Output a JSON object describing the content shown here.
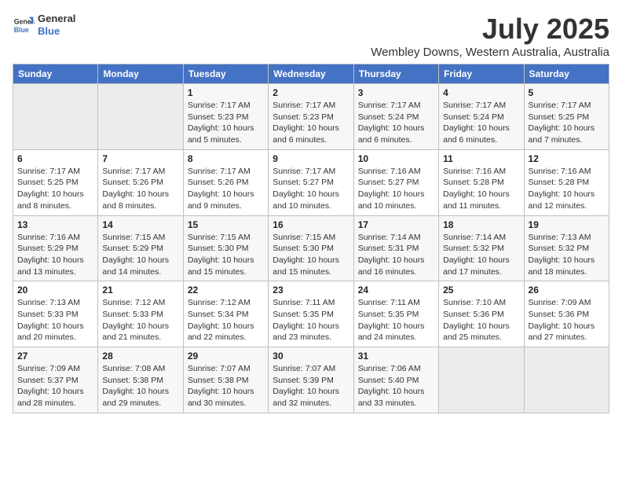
{
  "header": {
    "logo_line1": "General",
    "logo_line2": "Blue",
    "month": "July 2025",
    "location": "Wembley Downs, Western Australia, Australia"
  },
  "weekdays": [
    "Sunday",
    "Monday",
    "Tuesday",
    "Wednesday",
    "Thursday",
    "Friday",
    "Saturday"
  ],
  "weeks": [
    [
      {
        "day": "",
        "info": ""
      },
      {
        "day": "",
        "info": ""
      },
      {
        "day": "1",
        "info": "Sunrise: 7:17 AM\nSunset: 5:23 PM\nDaylight: 10 hours and 5 minutes."
      },
      {
        "day": "2",
        "info": "Sunrise: 7:17 AM\nSunset: 5:23 PM\nDaylight: 10 hours and 6 minutes."
      },
      {
        "day": "3",
        "info": "Sunrise: 7:17 AM\nSunset: 5:24 PM\nDaylight: 10 hours and 6 minutes."
      },
      {
        "day": "4",
        "info": "Sunrise: 7:17 AM\nSunset: 5:24 PM\nDaylight: 10 hours and 6 minutes."
      },
      {
        "day": "5",
        "info": "Sunrise: 7:17 AM\nSunset: 5:25 PM\nDaylight: 10 hours and 7 minutes."
      }
    ],
    [
      {
        "day": "6",
        "info": "Sunrise: 7:17 AM\nSunset: 5:25 PM\nDaylight: 10 hours and 8 minutes."
      },
      {
        "day": "7",
        "info": "Sunrise: 7:17 AM\nSunset: 5:26 PM\nDaylight: 10 hours and 8 minutes."
      },
      {
        "day": "8",
        "info": "Sunrise: 7:17 AM\nSunset: 5:26 PM\nDaylight: 10 hours and 9 minutes."
      },
      {
        "day": "9",
        "info": "Sunrise: 7:17 AM\nSunset: 5:27 PM\nDaylight: 10 hours and 10 minutes."
      },
      {
        "day": "10",
        "info": "Sunrise: 7:16 AM\nSunset: 5:27 PM\nDaylight: 10 hours and 10 minutes."
      },
      {
        "day": "11",
        "info": "Sunrise: 7:16 AM\nSunset: 5:28 PM\nDaylight: 10 hours and 11 minutes."
      },
      {
        "day": "12",
        "info": "Sunrise: 7:16 AM\nSunset: 5:28 PM\nDaylight: 10 hours and 12 minutes."
      }
    ],
    [
      {
        "day": "13",
        "info": "Sunrise: 7:16 AM\nSunset: 5:29 PM\nDaylight: 10 hours and 13 minutes."
      },
      {
        "day": "14",
        "info": "Sunrise: 7:15 AM\nSunset: 5:29 PM\nDaylight: 10 hours and 14 minutes."
      },
      {
        "day": "15",
        "info": "Sunrise: 7:15 AM\nSunset: 5:30 PM\nDaylight: 10 hours and 15 minutes."
      },
      {
        "day": "16",
        "info": "Sunrise: 7:15 AM\nSunset: 5:30 PM\nDaylight: 10 hours and 15 minutes."
      },
      {
        "day": "17",
        "info": "Sunrise: 7:14 AM\nSunset: 5:31 PM\nDaylight: 10 hours and 16 minutes."
      },
      {
        "day": "18",
        "info": "Sunrise: 7:14 AM\nSunset: 5:32 PM\nDaylight: 10 hours and 17 minutes."
      },
      {
        "day": "19",
        "info": "Sunrise: 7:13 AM\nSunset: 5:32 PM\nDaylight: 10 hours and 18 minutes."
      }
    ],
    [
      {
        "day": "20",
        "info": "Sunrise: 7:13 AM\nSunset: 5:33 PM\nDaylight: 10 hours and 20 minutes."
      },
      {
        "day": "21",
        "info": "Sunrise: 7:12 AM\nSunset: 5:33 PM\nDaylight: 10 hours and 21 minutes."
      },
      {
        "day": "22",
        "info": "Sunrise: 7:12 AM\nSunset: 5:34 PM\nDaylight: 10 hours and 22 minutes."
      },
      {
        "day": "23",
        "info": "Sunrise: 7:11 AM\nSunset: 5:35 PM\nDaylight: 10 hours and 23 minutes."
      },
      {
        "day": "24",
        "info": "Sunrise: 7:11 AM\nSunset: 5:35 PM\nDaylight: 10 hours and 24 minutes."
      },
      {
        "day": "25",
        "info": "Sunrise: 7:10 AM\nSunset: 5:36 PM\nDaylight: 10 hours and 25 minutes."
      },
      {
        "day": "26",
        "info": "Sunrise: 7:09 AM\nSunset: 5:36 PM\nDaylight: 10 hours and 27 minutes."
      }
    ],
    [
      {
        "day": "27",
        "info": "Sunrise: 7:09 AM\nSunset: 5:37 PM\nDaylight: 10 hours and 28 minutes."
      },
      {
        "day": "28",
        "info": "Sunrise: 7:08 AM\nSunset: 5:38 PM\nDaylight: 10 hours and 29 minutes."
      },
      {
        "day": "29",
        "info": "Sunrise: 7:07 AM\nSunset: 5:38 PM\nDaylight: 10 hours and 30 minutes."
      },
      {
        "day": "30",
        "info": "Sunrise: 7:07 AM\nSunset: 5:39 PM\nDaylight: 10 hours and 32 minutes."
      },
      {
        "day": "31",
        "info": "Sunrise: 7:06 AM\nSunset: 5:40 PM\nDaylight: 10 hours and 33 minutes."
      },
      {
        "day": "",
        "info": ""
      },
      {
        "day": "",
        "info": ""
      }
    ]
  ]
}
